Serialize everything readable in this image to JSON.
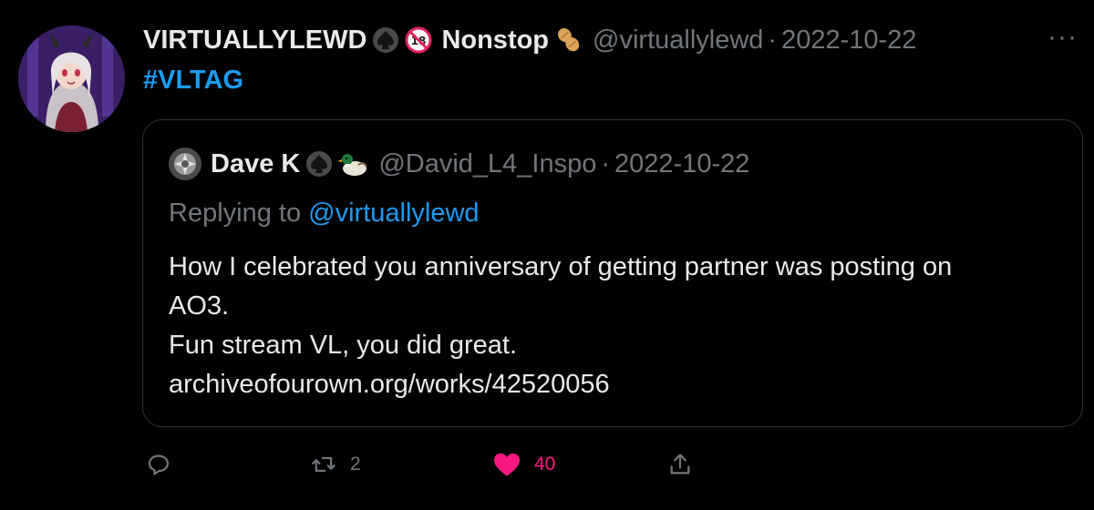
{
  "tweet": {
    "author_name": "VIRTUALLYLEWD",
    "author_emoji_1": "♠",
    "author_emoji_2": "🔞",
    "author_name_suffix": "Nonstop",
    "author_emoji_3": "🥜",
    "handle": "@virtuallylewd",
    "separator": "·",
    "date": "2022-10-22",
    "more_label": "···",
    "text": "#VLTAG"
  },
  "quote": {
    "author_name": "Dave K",
    "author_emoji_1": "♠",
    "author_emoji_2": "🦆",
    "handle": "@David_L4_Inspo",
    "separator": "·",
    "date": "2022-10-22",
    "replying_prefix": "Replying to",
    "replying_mention": "@virtuallylewd",
    "lines": [
      "How I celebrated you anniversary of getting partner was posting on",
      "AO3.",
      "Fun stream VL, you did great.",
      "archiveofourown.org/works/42520056"
    ]
  },
  "actions": {
    "reply_icon": "reply-icon",
    "retweet_icon": "retweet-icon",
    "retweet_count": "2",
    "like_icon": "heart-icon",
    "like_count": "40",
    "share_icon": "share-icon"
  },
  "colors": {
    "background": "#000000",
    "text_primary": "#e7e9ea",
    "text_secondary": "#71767b",
    "link": "#1d9bf0",
    "like": "#f91880",
    "border": "#2f3336"
  }
}
